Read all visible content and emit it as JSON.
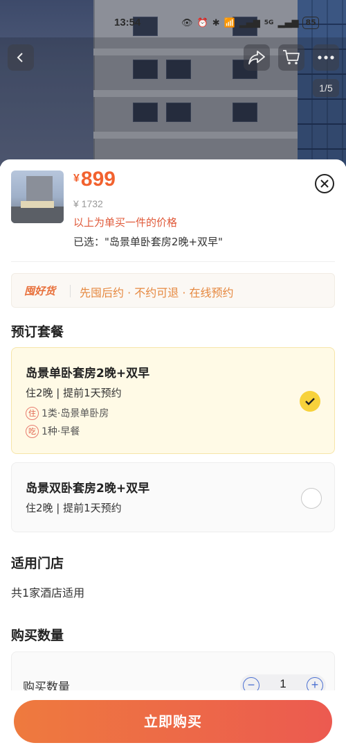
{
  "status_bar": {
    "time": "13:54",
    "network": "5G",
    "battery": "85"
  },
  "gallery": {
    "page_indicator": "1/5"
  },
  "product": {
    "currency": "¥",
    "price": "899",
    "original_price": "¥ 1732",
    "price_note": "以上为单买一件的价格",
    "selected": "已选：\"岛景单卧套房2晚+双早\""
  },
  "promo": {
    "logo": "囤好货",
    "text": "先囤后约 · 不约可退 · 在线预约"
  },
  "booking": {
    "title": "预订套餐",
    "packages": [
      {
        "name": "岛景单卧套房2晚+双早",
        "sub": "住2晚 | 提前1天预约",
        "items": [
          {
            "tag": "住",
            "text": "1类·岛景单卧房"
          },
          {
            "tag": "吃",
            "text": "1种·早餐"
          }
        ],
        "selected": true
      },
      {
        "name": "岛景双卧套房2晚+双早",
        "sub": "住2晚 | 提前1天预约",
        "selected": false
      }
    ]
  },
  "stores": {
    "title": "适用门店",
    "text": "共1家酒店适用"
  },
  "quantity": {
    "title": "购买数量",
    "label": "购买数量",
    "value": "1",
    "minus": "−",
    "plus": "+"
  },
  "buy_button": "立即购买",
  "colors": {
    "accent": "#f2622f",
    "selected_bg": "#fffae6",
    "check": "#f7d23b",
    "stepper": "#4a6fd1"
  }
}
